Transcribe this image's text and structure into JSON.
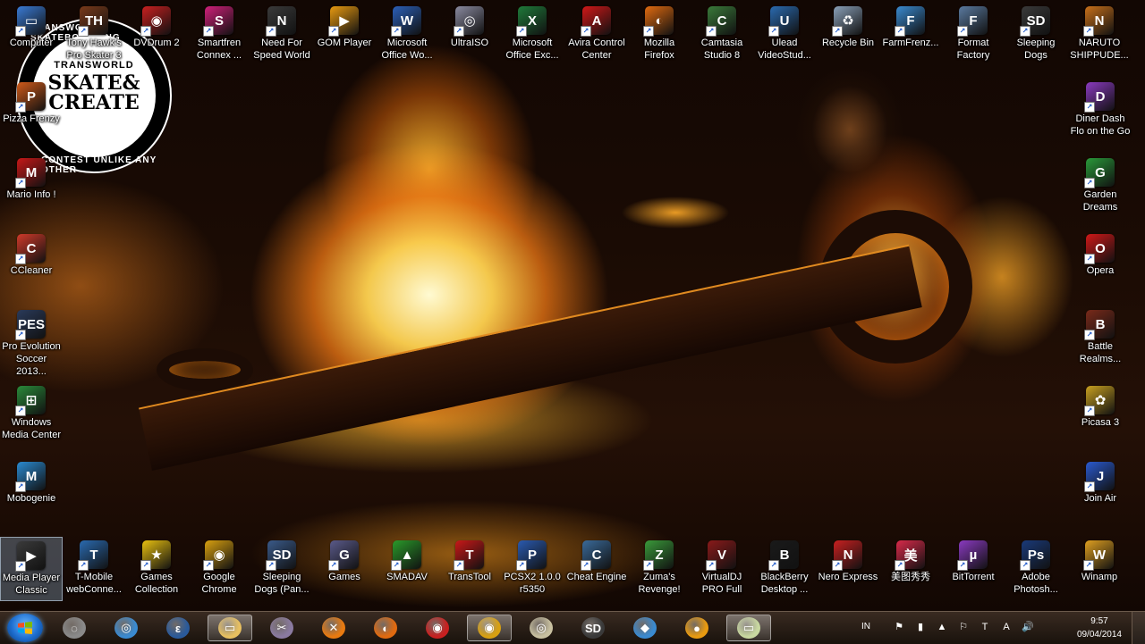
{
  "desktop": {
    "logo": {
      "line1": "TRANSWORLD",
      "line2": "SKATE&",
      "line3": "CREATE",
      "ring_top": "TRANSWORLD SKATEBOARDING",
      "ring_bottom": "CONTEST UNLIKE ANY OTHER"
    },
    "icons_top": [
      {
        "label": "Computer",
        "color": "#3a7bd5",
        "glyph": "▭"
      },
      {
        "label": "Tony Hawk's\nPro Skater 3",
        "color": "#7a3a1a",
        "glyph": "TH"
      },
      {
        "label": "DVDrum 2",
        "color": "#c82020",
        "glyph": "◉"
      },
      {
        "label": "Smartfren\nConnex ...",
        "color": "#d0207a",
        "glyph": "S"
      },
      {
        "label": "Need For\nSpeed World",
        "color": "#3a3a3a",
        "glyph": "N"
      },
      {
        "label": "GOM Player",
        "color": "#e89a10",
        "glyph": "▶"
      },
      {
        "label": "Microsoft\nOffice Wo...",
        "color": "#2b5fb8",
        "glyph": "W"
      },
      {
        "label": "UltraISO",
        "color": "#8a8aa0",
        "glyph": "◎"
      },
      {
        "label": "Microsoft\nOffice Exc...",
        "color": "#1f7a3a",
        "glyph": "X"
      },
      {
        "label": "Avira Control\nCenter",
        "color": "#d01818",
        "glyph": "A"
      },
      {
        "label": "Mozilla\nFirefox",
        "color": "#e06a10",
        "glyph": "◐"
      },
      {
        "label": "Camtasia\nStudio 8",
        "color": "#3a7a3a",
        "glyph": "C"
      },
      {
        "label": "Ulead\nVideoStud...",
        "color": "#2a6ab0",
        "glyph": "U"
      },
      {
        "label": "Recycle Bin",
        "color": "#8aa0b8",
        "glyph": "♻"
      },
      {
        "label": "FarmFrenz...",
        "color": "#3a8ad0",
        "glyph": "F"
      },
      {
        "label": "Format\nFactory",
        "color": "#5a7aa0",
        "glyph": "F"
      },
      {
        "label": "Sleeping\nDogs",
        "color": "#3a3a3a",
        "glyph": "SD"
      },
      {
        "label": "NARUTO\nSHIPPUDE...",
        "color": "#c8701a",
        "glyph": "N"
      }
    ],
    "icons_left": [
      {
        "label": "Pizza Frenzy",
        "color": "#d05a1a",
        "glyph": "P"
      },
      {
        "label": "Mario Info !",
        "color": "#c81818",
        "glyph": "M"
      },
      {
        "label": "CCleaner",
        "color": "#d03a2a",
        "glyph": "C"
      },
      {
        "label": "Pro Evolution\nSoccer 2013...",
        "color": "#2a3a5a",
        "glyph": "PES"
      },
      {
        "label": "Windows\nMedia Center",
        "color": "#2a8a3a",
        "glyph": "⊞"
      },
      {
        "label": "Mobogenie",
        "color": "#2a8ad0",
        "glyph": "M"
      }
    ],
    "icons_right": [
      {
        "label": "Diner Dash\nFlo on the Go",
        "color": "#8a3ac0",
        "glyph": "D"
      },
      {
        "label": "Garden\nDreams",
        "color": "#2a9a3a",
        "glyph": "G"
      },
      {
        "label": "Opera",
        "color": "#d01818",
        "glyph": "O"
      },
      {
        "label": "Battle\nRealms...",
        "color": "#7a2a1a",
        "glyph": "B"
      },
      {
        "label": "Picasa 3",
        "color": "#c8a020",
        "glyph": "✿"
      },
      {
        "label": "Join Air",
        "color": "#2a5ad0",
        "glyph": "J"
      }
    ],
    "icons_bottom": [
      {
        "label": "Media Player\nClassic",
        "color": "#3a3a3a",
        "glyph": "▶",
        "selected": true
      },
      {
        "label": "T-Mobile\nwebConne...",
        "color": "#2a6ab0",
        "glyph": "T"
      },
      {
        "label": "Games\nCollection",
        "color": "#e8c010",
        "glyph": "★"
      },
      {
        "label": "Google\nChrome",
        "color": "#d8a010",
        "glyph": "◉"
      },
      {
        "label": "Sleeping\nDogs (Pan...",
        "color": "#3a5a8a",
        "glyph": "SD"
      },
      {
        "label": "Games",
        "color": "#5a5a8a",
        "glyph": "G"
      },
      {
        "label": "SMADAV",
        "color": "#2a9a2a",
        "glyph": "▲"
      },
      {
        "label": "TransTool",
        "color": "#c81818",
        "glyph": "T"
      },
      {
        "label": "PCSX2 1.0.0\nr5350",
        "color": "#2a5ab0",
        "glyph": "P"
      },
      {
        "label": "Cheat Engine",
        "color": "#3a6a9a",
        "glyph": "C"
      },
      {
        "label": "Zuma's\nRevenge!",
        "color": "#3a9a3a",
        "glyph": "Z"
      },
      {
        "label": "VirtualDJ\nPRO Full",
        "color": "#8a1a1a",
        "glyph": "V"
      },
      {
        "label": "BlackBerry\nDesktop ...",
        "color": "#1a1a1a",
        "glyph": "B"
      },
      {
        "label": "Nero Express",
        "color": "#c82020",
        "glyph": "N"
      },
      {
        "label": "美图秀秀",
        "color": "#d82a4a",
        "glyph": "美"
      },
      {
        "label": "BitTorrent",
        "color": "#8a3ac0",
        "glyph": "µ"
      },
      {
        "label": "Adobe\nPhotosh...",
        "color": "#1a3a7a",
        "glyph": "Ps"
      },
      {
        "label": "Winamp",
        "color": "#e0a020",
        "glyph": "W"
      }
    ]
  },
  "taskbar": {
    "start_label": "Start",
    "pinned": [
      {
        "name": "taskbar-app-1",
        "color": "#8a8a8a",
        "glyph": "◌"
      },
      {
        "name": "taskbar-app-2",
        "color": "#3a8ad0",
        "glyph": "◎"
      },
      {
        "name": "taskbar-app-3",
        "color": "#2a5a9a",
        "glyph": "ε"
      },
      {
        "name": "taskbar-explorer",
        "color": "#e8c060",
        "glyph": "▭",
        "active": true
      },
      {
        "name": "taskbar-app-5",
        "color": "#8a7aa0",
        "glyph": "✂"
      },
      {
        "name": "taskbar-app-6",
        "color": "#e87a10",
        "glyph": "✕"
      },
      {
        "name": "taskbar-firefox",
        "color": "#e06a10",
        "glyph": "◐"
      },
      {
        "name": "taskbar-app-8",
        "color": "#c82020",
        "glyph": "◉"
      },
      {
        "name": "taskbar-chrome",
        "color": "#d8a010",
        "glyph": "◉",
        "active": true
      },
      {
        "name": "taskbar-app-10",
        "color": "#c8c0a0",
        "glyph": "◎"
      },
      {
        "name": "taskbar-sleeping-dogs",
        "color": "#3a3a3a",
        "glyph": "SD"
      },
      {
        "name": "taskbar-app-12",
        "color": "#3a8ad0",
        "glyph": "◆"
      },
      {
        "name": "taskbar-app-13",
        "color": "#e89a10",
        "glyph": "●"
      },
      {
        "name": "taskbar-app-14",
        "color": "#c8d8a0",
        "glyph": "▭",
        "active": true
      }
    ],
    "tray": {
      "language": "IN",
      "icons": [
        "⚑",
        "▮",
        "▲",
        "⚐",
        "T",
        "A",
        "🔊"
      ],
      "time": "9:57",
      "date": "09/04/2014"
    }
  }
}
